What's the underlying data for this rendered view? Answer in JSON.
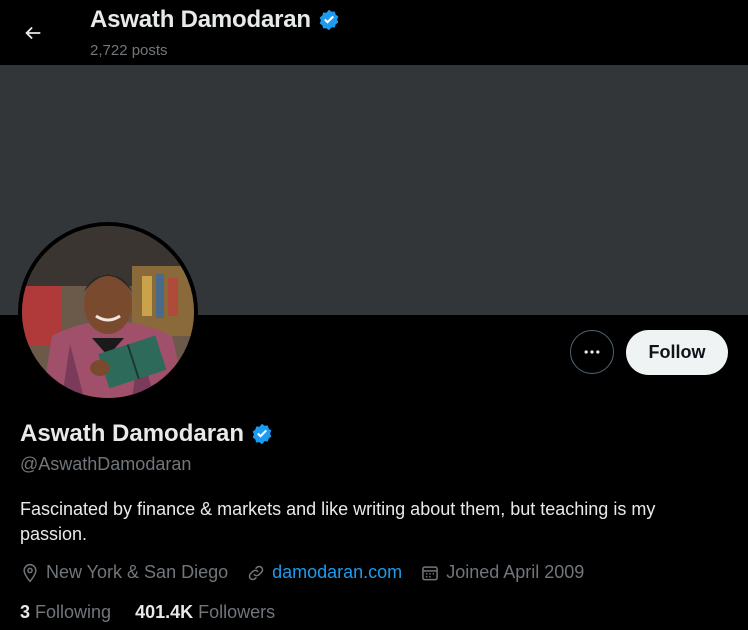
{
  "header": {
    "name": "Aswath Damodaran",
    "posts": "2,722 posts"
  },
  "profile": {
    "name": "Aswath Damodaran",
    "handle": "@AswathDamodaran",
    "bio": "Fascinated by finance & markets and like writing about them, but teaching is my passion.",
    "location": "New York & San Diego",
    "website": "damodaran.com",
    "joined": "Joined April 2009",
    "following_count": "3",
    "following_label": "Following",
    "followers_count": "401.4K",
    "followers_label": "Followers"
  },
  "actions": {
    "follow_label": "Follow"
  },
  "icons": {
    "back": "arrow-left-icon",
    "verified": "verified-badge-icon",
    "more": "more-icon",
    "location": "location-pin-icon",
    "link": "link-icon",
    "calendar": "calendar-icon"
  },
  "colors": {
    "accent": "#1d9bf0",
    "banner": "#333639",
    "muted": "#71767b"
  }
}
